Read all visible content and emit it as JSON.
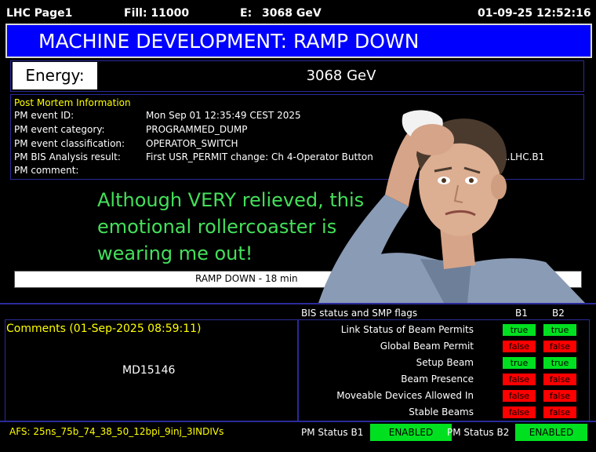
{
  "header": {
    "page": "LHC Page1",
    "fill": "Fill: 11000",
    "energy_label": "E:",
    "energy_value": "3068 GeV",
    "datetime": "01-09-25 12:52:16"
  },
  "title": "MACHINE DEVELOPMENT: RAMP DOWN",
  "energy": {
    "label": "Energy:",
    "value": "3068 GeV"
  },
  "post_mortem": {
    "title": "Post Mortem Information",
    "rows": [
      {
        "label": "PM event ID:",
        "value": "Mon Sep 01 12:35:49 CEST 2025"
      },
      {
        "label": "PM event category:",
        "value": "PROGRAMMED_DUMP"
      },
      {
        "label": "PM event classification:",
        "value": "OPERATOR_SWITCH"
      },
      {
        "label": "PM BIS Analysis result:",
        "value": "First USR_PERMIT change: Ch 4-Operator Button"
      },
      {
        "label": "PM comment:",
        "value": ""
      }
    ],
    "bis_suffix": "CCR.LHC.B1"
  },
  "overlay_text": "Although VERY relieved, this emotional rollercoaster is wearing me out!",
  "progress": {
    "text": "RAMP DOWN - 18 min"
  },
  "bis": {
    "header": "BIS status and SMP flags",
    "col_b1": "B1",
    "col_b2": "B2",
    "flags": [
      {
        "label": "Link Status of Beam Permits",
        "b1": "true",
        "b2": "true"
      },
      {
        "label": "Global Beam Permit",
        "b1": "false",
        "b2": "false"
      },
      {
        "label": "Setup Beam",
        "b1": "true",
        "b2": "true"
      },
      {
        "label": "Beam Presence",
        "b1": "false",
        "b2": "false"
      },
      {
        "label": "Moveable Devices Allowed In",
        "b1": "false",
        "b2": "false"
      },
      {
        "label": "Stable Beams",
        "b1": "false",
        "b2": "false"
      }
    ]
  },
  "comments": {
    "title": "Comments (01-Sep-2025 08:59:11)",
    "text": "MD15146"
  },
  "footer": {
    "afs": "AFS: 25ns_75b_74_38_50_12bpi_9inj_3INDIVs",
    "pm_status_b1_label": "PM Status B1",
    "pm_status_b1": "ENABLED",
    "pm_status_b2_label": "PM Status B2",
    "pm_status_b2": "ENABLED"
  },
  "colors": {
    "title_bg": "#0000ff",
    "true": "#00e020",
    "false": "#ff0000",
    "accent_yellow": "#ffff00",
    "overlay_green": "#44e05a"
  }
}
